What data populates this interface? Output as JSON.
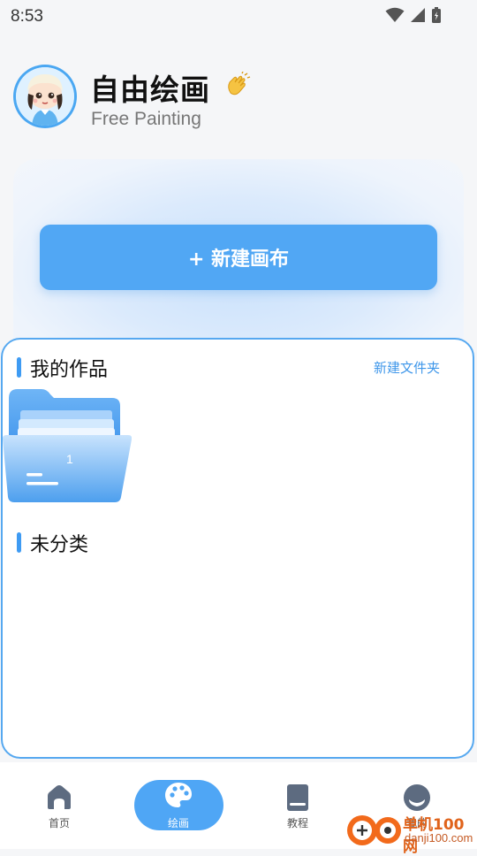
{
  "status_bar": {
    "time": "8:53"
  },
  "header": {
    "title": "自由绘画",
    "subtitle": "Free Painting",
    "emoji": "👏"
  },
  "hero": {
    "new_canvas_label": "+ 新建画布"
  },
  "works": {
    "title": "我的作品",
    "new_folder_label": "新建文件夹",
    "folders": [
      {
        "count": "1"
      }
    ],
    "uncategorized_title": "未分类"
  },
  "bottom_nav": {
    "items": [
      {
        "label": "首页",
        "icon": "home-icon",
        "active": false
      },
      {
        "label": "绘画",
        "icon": "palette-icon",
        "active": true
      },
      {
        "label": "教程",
        "icon": "book-icon",
        "active": false
      },
      {
        "label": "我的",
        "icon": "profile-icon",
        "active": false
      }
    ]
  },
  "watermark": {
    "text": "单机100网",
    "subtext": "danji100.com"
  },
  "colors": {
    "accent": "#4fa6f5",
    "panel_border": "#56a8f0",
    "link": "#3f97ea"
  }
}
